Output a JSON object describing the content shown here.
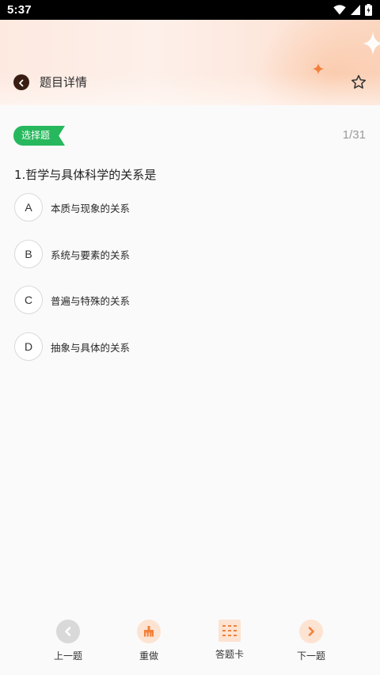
{
  "status_bar": {
    "time": "5:37",
    "icons": [
      "wifi-icon",
      "cell-signal-icon",
      "battery-icon"
    ]
  },
  "header": {
    "title": "题目详情",
    "back_icon": "chevron-left-icon",
    "favorite_icon": "star-outline-icon"
  },
  "question": {
    "type_label": "选择题",
    "progress": "1/31",
    "text": "1.哲学与具体科学的关系是",
    "options": [
      {
        "letter": "A",
        "text": "本质与现象的关系"
      },
      {
        "letter": "B",
        "text": "系统与要素的关系"
      },
      {
        "letter": "C",
        "text": "普遍与特殊的关系"
      },
      {
        "letter": "D",
        "text": "抽象与具体的关系"
      }
    ]
  },
  "bottom_nav": {
    "prev_label": "上一题",
    "redo_label": "重做",
    "answer_card_label": "答题卡",
    "next_label": "下一题"
  },
  "colors": {
    "badge_green": "#27b85d",
    "accent_orange": "#f2803a",
    "header_dark": "#3a1d12"
  }
}
